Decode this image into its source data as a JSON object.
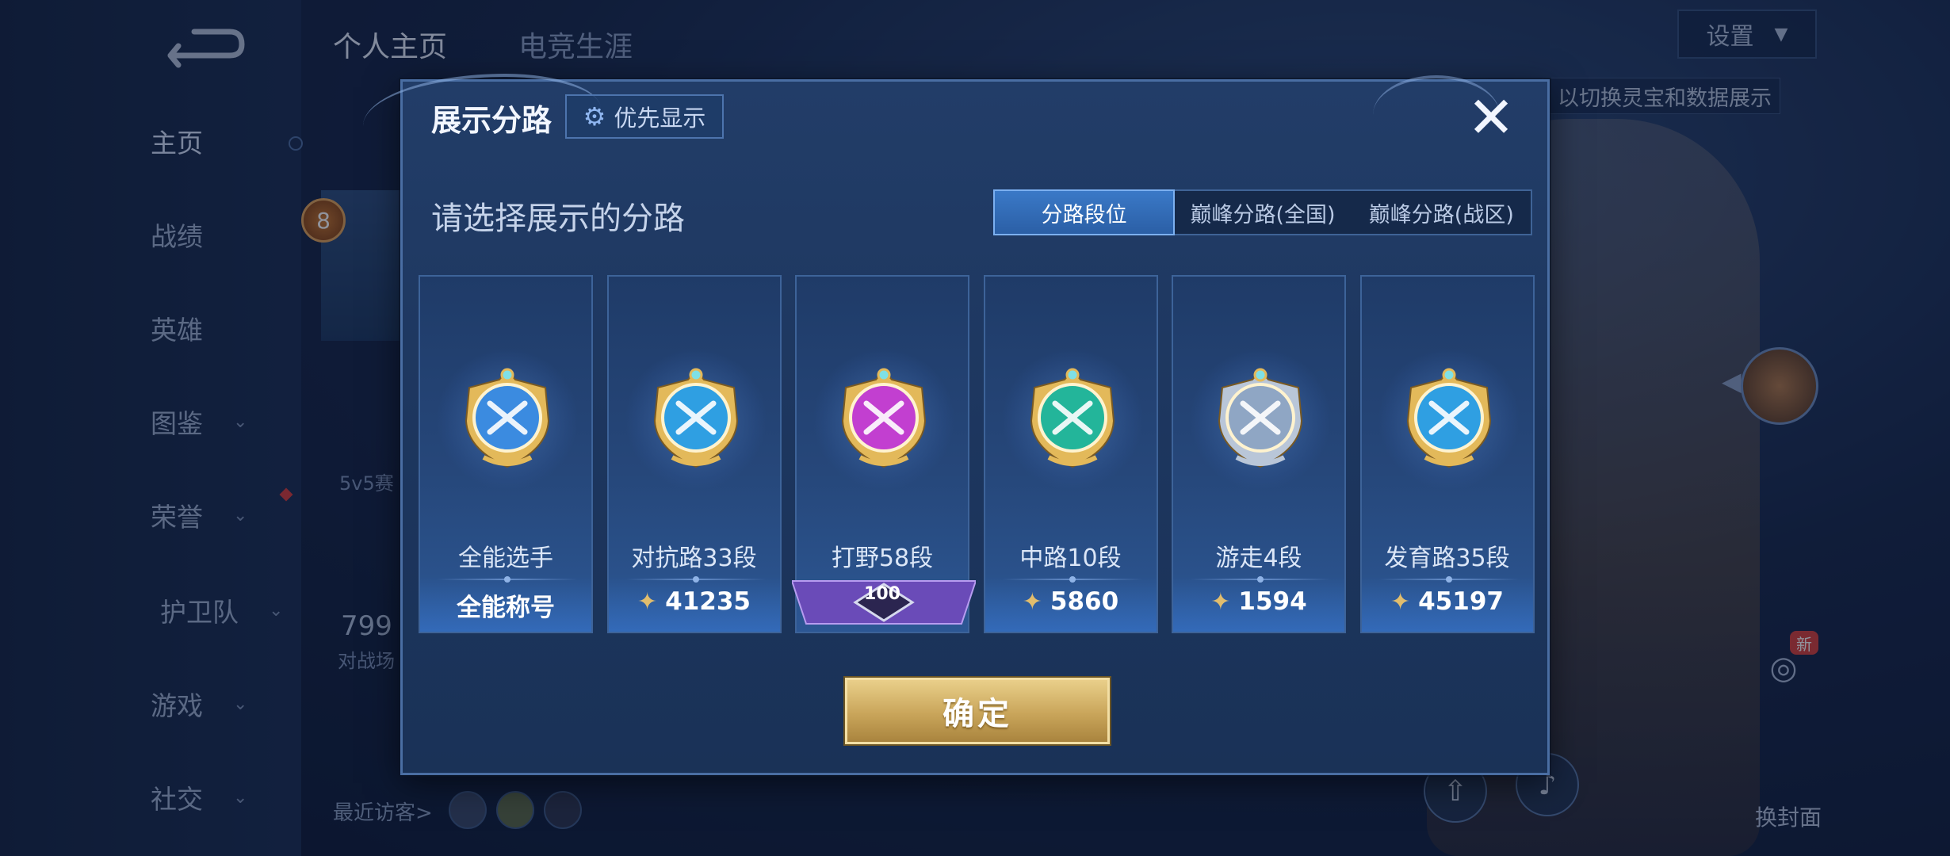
{
  "background": {
    "top_tabs": [
      {
        "label": "个人主页",
        "active": true
      },
      {
        "label": "电竞生涯",
        "active": false
      }
    ],
    "sidebar": [
      {
        "label": "主页",
        "active": true,
        "has_chevron": false
      },
      {
        "label": "战绩",
        "active": false,
        "has_chevron": false
      },
      {
        "label": "英雄",
        "active": false,
        "has_chevron": false
      },
      {
        "label": "图鉴",
        "active": false,
        "has_chevron": true
      },
      {
        "label": "荣誉",
        "active": false,
        "has_chevron": true
      },
      {
        "label": "护卫队",
        "active": false,
        "has_chevron": true
      },
      {
        "label": "游戏",
        "active": false,
        "has_chevron": true
      },
      {
        "label": "社交",
        "active": false,
        "has_chevron": true
      }
    ],
    "settings_label": "设置",
    "hint": "以切换灵宝和数据展示",
    "level": "8",
    "rank_mode": "5v5赛",
    "stat_number": "799",
    "stat_label": "对战场",
    "visitors_label": "最近访客>",
    "change_cover_label": "换封面",
    "new_badge": "新"
  },
  "modal": {
    "title": "展示分路",
    "priority_button": "优先显示",
    "prompt": "请选择展示的分路",
    "tabs": [
      {
        "label": "分路段位",
        "active": true
      },
      {
        "label": "巅峰分路(全国)",
        "active": false
      },
      {
        "label": "巅峰分路(战区)",
        "active": false
      }
    ],
    "lanes": [
      {
        "label": "全能选手",
        "value": "全能称号",
        "kind": "title",
        "emblem_color": "#3b8be0",
        "icon": "all-round-emblem-icon"
      },
      {
        "label": "对抗路33段",
        "value": "41235",
        "kind": "points",
        "emblem_color": "#2f9fe2",
        "icon": "clash-lane-emblem-icon"
      },
      {
        "label": "打野58段",
        "value": "100",
        "kind": "rank",
        "emblem_color": "#c23fd0",
        "icon": "jungle-emblem-icon"
      },
      {
        "label": "中路10段",
        "value": "5860",
        "kind": "points",
        "emblem_color": "#23b59a",
        "icon": "mid-lane-emblem-icon"
      },
      {
        "label": "游走4段",
        "value": "1594",
        "kind": "points",
        "emblem_color": "#8fa6c4",
        "icon": "roam-emblem-icon"
      },
      {
        "label": "发育路35段",
        "value": "45197",
        "kind": "points",
        "emblem_color": "#2f9fe2",
        "icon": "farm-lane-emblem-icon"
      }
    ],
    "confirm_button": "确定"
  }
}
